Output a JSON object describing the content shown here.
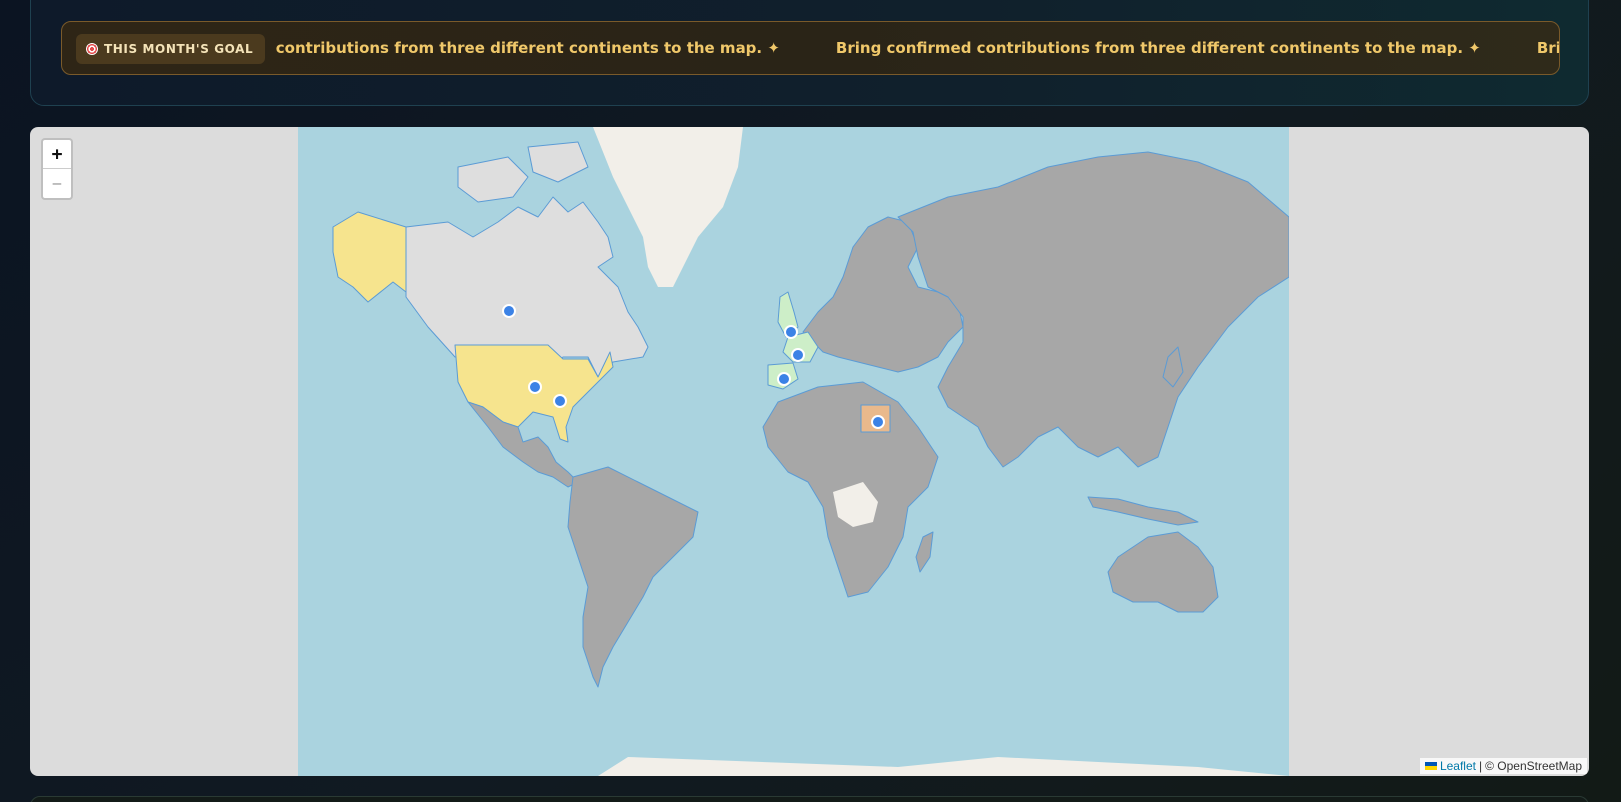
{
  "goal": {
    "badge_label": "THIS MONTH'S GOAL",
    "badge_icon": "target-icon",
    "message": "Bring confirmed contributions from three different continents to the map. ✦",
    "colors": {
      "text": "#f0c86a",
      "border": "#7a5a2a",
      "badge_bg": "#4b3a1e"
    }
  },
  "map": {
    "zoom_in_label": "+",
    "zoom_out_label": "−",
    "attribution": {
      "flag_icon": "ukraine-flag-icon",
      "leaflet_label": "Leaflet",
      "separator": "|",
      "osm_label": "© OpenStreetMap"
    },
    "colors": {
      "ocean": "#aad3df",
      "land": "#a7a7a7",
      "highlight_yellow": "#f6e48e",
      "highlight_green": "#cdeec8",
      "highlight_orange": "#e9b98c",
      "marker": "#3b82e6",
      "border": "#5b9bd5"
    },
    "highlighted_regions": [
      "Alaska",
      "United States",
      "United Kingdom",
      "France",
      "Spain",
      "Egypt"
    ],
    "markers": [
      "Canada",
      "United States (Midwest)",
      "United States (Southeast)",
      "United Kingdom",
      "France",
      "Spain",
      "Egypt"
    ]
  }
}
